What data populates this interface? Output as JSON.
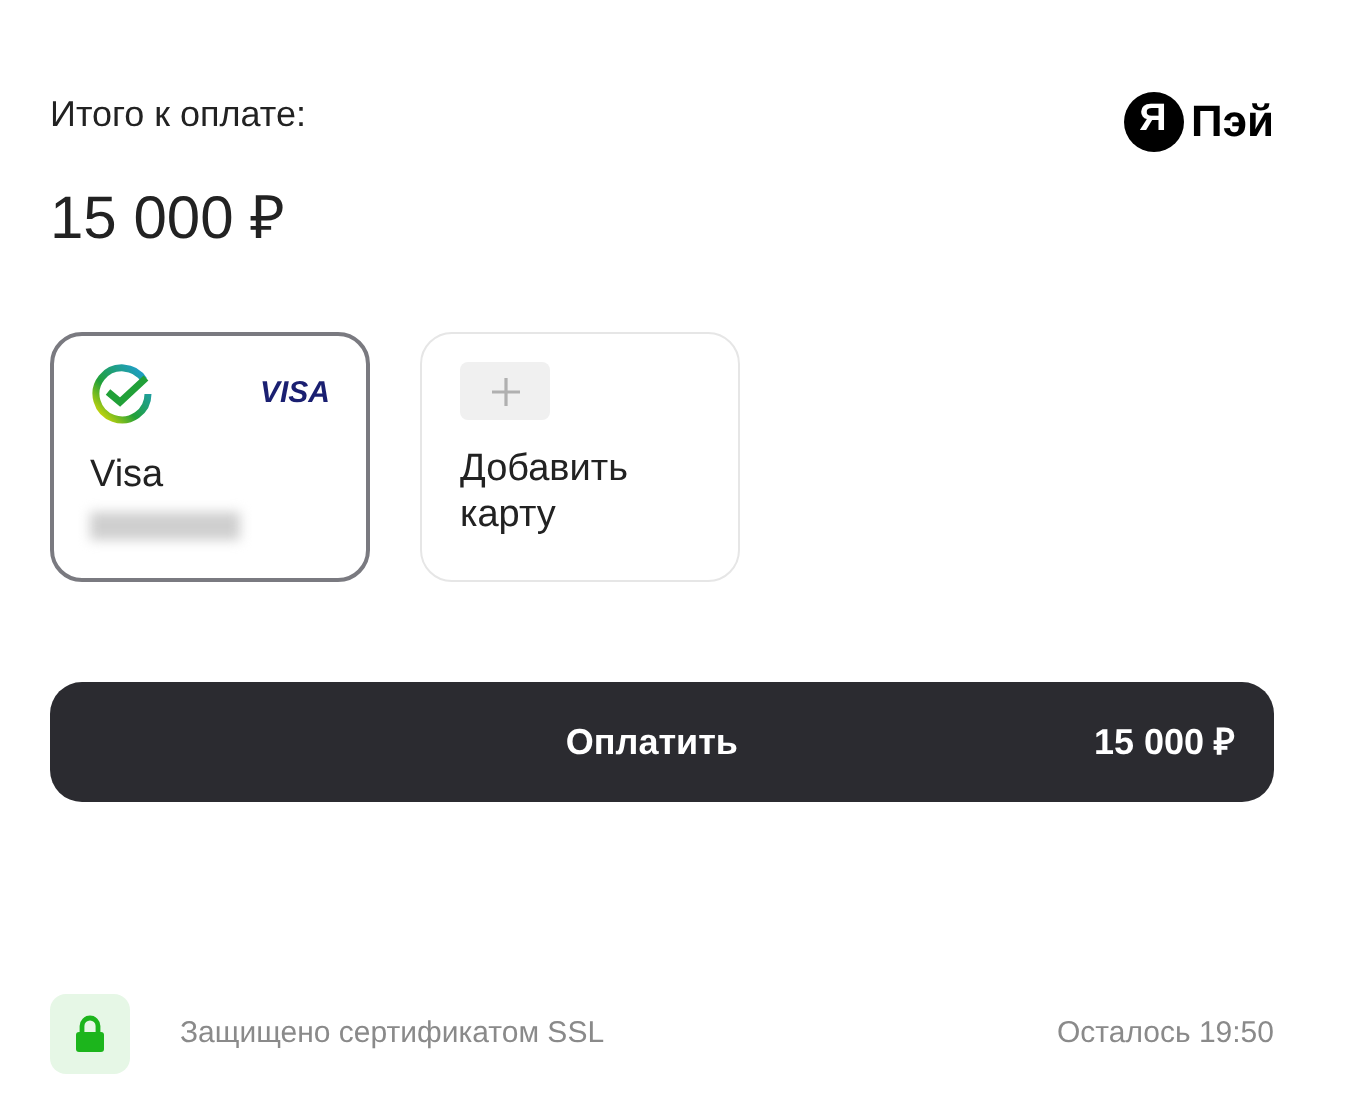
{
  "total_label": "Итого к оплате:",
  "total_amount": "15 000 ₽",
  "logo": {
    "mark": "Я",
    "text": "Пэй"
  },
  "cards": [
    {
      "kind": "card",
      "name": "Visa",
      "brand": "VISA",
      "selected": true
    },
    {
      "kind": "add",
      "label": "Добавить карту",
      "selected": false
    }
  ],
  "pay_button": {
    "label": "Оплатить",
    "amount": "15 000 ₽"
  },
  "footer": {
    "security": "Защищено сертификатом SSL",
    "timer": "Осталось 19:50"
  }
}
